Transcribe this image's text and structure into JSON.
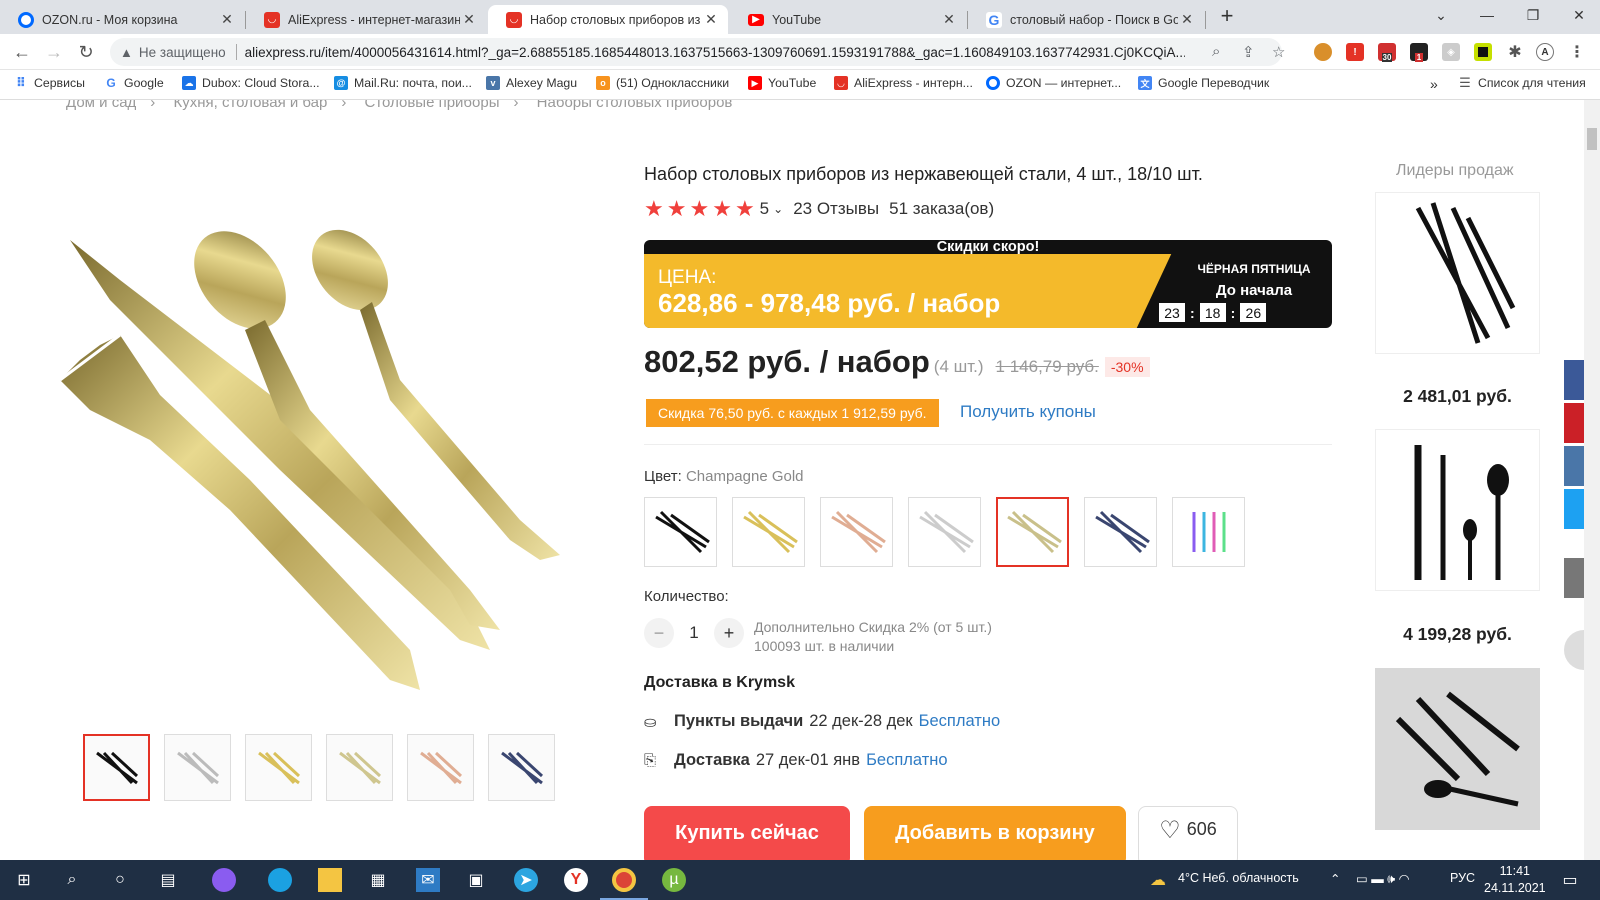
{
  "browser": {
    "tabs": [
      {
        "title": "OZON.ru - Моя корзина",
        "close": "✕",
        "icon": "ozon-icon",
        "color": "#0069ff"
      },
      {
        "title": "AliExpress - интернет-магазин э",
        "close": "✕",
        "icon": "aliexpress-icon",
        "color": "#e43225"
      },
      {
        "title": "Набор столовых приборов из н",
        "close": "✕",
        "icon": "aliexpress-icon",
        "color": "#e43225"
      },
      {
        "title": "YouTube",
        "close": "✕",
        "icon": "youtube-icon",
        "color": "#ff0000"
      },
      {
        "title": "столовый набор - Поиск в Goo",
        "close": "✕",
        "icon": "google-icon",
        "color": "#4285f4"
      }
    ],
    "new_tab": "+",
    "address": {
      "security": "Не защищено",
      "url": "aliexpress.ru/item/4000056431614.html?_ga=2.68855185.1685448013.1637515663-1309760691.1593191788&_gac=1.160849103.1637742931.Cj0KCQiA..."
    },
    "bookmarks": [
      {
        "label": "Сервисы",
        "icon": "apps-grid-icon",
        "color": "#4285f4"
      },
      {
        "label": "Google",
        "icon": "google-icon",
        "color": "#4285f4"
      },
      {
        "label": "Dubox: Cloud Stora...",
        "icon": "cloud-icon",
        "color": "#1a73e8"
      },
      {
        "label": "Mail.Ru: почта, пои...",
        "icon": "mailru-icon",
        "color": "#168de2"
      },
      {
        "label": "Alexey Magu",
        "icon": "vk-icon",
        "color": "#4a76a8"
      },
      {
        "label": "(51) Одноклассники",
        "icon": "ok-icon",
        "color": "#f7931e"
      },
      {
        "label": "YouTube",
        "icon": "youtube-icon",
        "color": "#ff0000"
      },
      {
        "label": "AliExpress - интерн...",
        "icon": "aliexpress-icon",
        "color": "#e43225"
      },
      {
        "label": "OZON — интернет...",
        "icon": "ozon-icon",
        "color": "#0069ff"
      },
      {
        "label": "Google Переводчик",
        "icon": "translate-icon",
        "color": "#4285f4"
      }
    ],
    "bookmarks_more": "»",
    "reading_list": "Список для чтения",
    "ext_badges": {
      "b1": "30",
      "b2": "1"
    },
    "avatar_letter": "A"
  },
  "breadcrumb": [
    "Дом и сад",
    "Кухня, столовая и бар",
    "Столовые приборы",
    "Наборы столовых приборов"
  ],
  "breadcrumb_sep": "›",
  "product": {
    "title": "Набор столовых приборов из нержавеющей стали, 4 шт., 18/10 шт.",
    "rating": "5",
    "rating_stars": 5,
    "reviews": "23 Отзывы",
    "orders": "51 заказа(ов)",
    "promo": {
      "soon": "Скидки скоро!",
      "price_label": "ЦЕНА:",
      "price_range": "628,86 - 978,48 руб. / набор",
      "event": "ЧЁРНАЯ ПЯТНИЦА",
      "until": "До начала",
      "timer": [
        "23",
        "18",
        "26"
      ]
    },
    "price": "802,52 руб. / набор",
    "pieces": "(4 шт.)",
    "old_price": "1 146,79 руб.",
    "discount": "-30%",
    "coupon": "Скидка 76,50 руб. с каждых 1 912,59 руб.",
    "coupon_link": "Получить купоны",
    "color_label": "Цвет:",
    "color_value": "Champagne Gold",
    "qty_label": "Количество:",
    "qty": "1",
    "qty_minus": "−",
    "qty_plus": "+",
    "qty_extra": "Дополнительно Скидка 2% (от 5 шт.)",
    "stock": "100093 шт. в наличии",
    "shipping_title": "Доставка в Krymsk",
    "pickup_label": "Пункты выдачи",
    "pickup_dates": "22 дек-28 дек",
    "pickup_price": "Бесплатно",
    "delivery_label": "Доставка",
    "delivery_dates": "27 дек-01 янв",
    "delivery_price": "Бесплатно",
    "buy_now": "Купить сейчас",
    "add_to_cart": "Добавить в корзину",
    "wishlist_count": "606"
  },
  "leaders": {
    "title": "Лидеры продаж",
    "prices": [
      "2 481,01 руб.",
      "4 199,28 руб."
    ]
  },
  "taskbar": {
    "weather": "4°C  Неб. облачность",
    "lang": "РУС",
    "time": "11:41",
    "date": "24.11.2021"
  }
}
